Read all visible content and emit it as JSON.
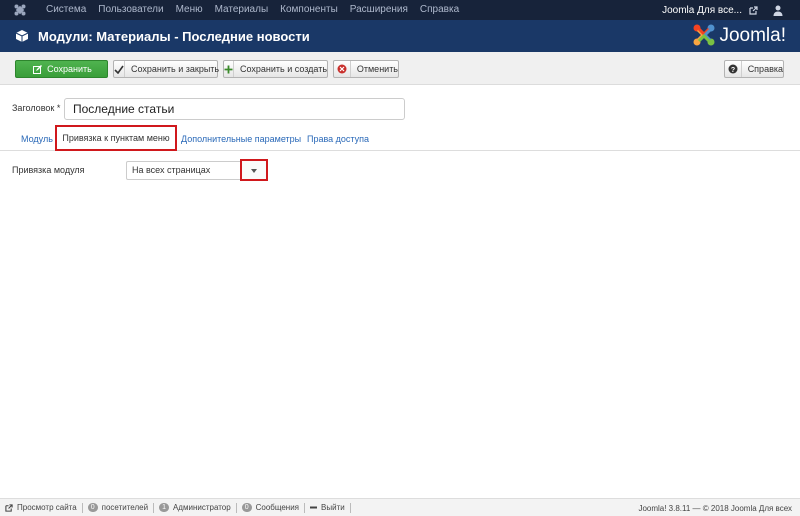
{
  "navbar": {
    "menu": [
      "Система",
      "Пользователи",
      "Меню",
      "Материалы",
      "Компоненты",
      "Расширения",
      "Справка"
    ],
    "site_link": "Joomla Для все...",
    "user_icon": "user-icon"
  },
  "header": {
    "title": "Модули: Материалы - Последние новости",
    "brand": "Joomla!"
  },
  "toolbar": {
    "save": "Сохранить",
    "save_close": "Сохранить и закрыть",
    "save_new": "Сохранить и создать",
    "cancel": "Отменить",
    "help": "Справка"
  },
  "form": {
    "title_label": "Заголовок *",
    "title_value": "Последние статьи",
    "assignment_label": "Привязка модуля",
    "assignment_value": "На всех страницах"
  },
  "tabs": [
    "Модуль",
    "Привязка к пунктам меню",
    "Дополнительные параметры",
    "Права доступа"
  ],
  "statusbar": {
    "preview": "Просмотр сайта",
    "visitors_count": "0",
    "visitors": "посетителей",
    "admins_count": "1",
    "admins": "Администратор",
    "messages_count": "0",
    "messages": "Сообщения",
    "logout": "Выйти",
    "version": "Joomla! 3.8.11 — © 2018 Joomla Для всех"
  },
  "colors": {
    "navbar": "#17233a",
    "titlebar": "#1a3867",
    "save_button": "#46a546",
    "highlight": "#d0181c"
  }
}
